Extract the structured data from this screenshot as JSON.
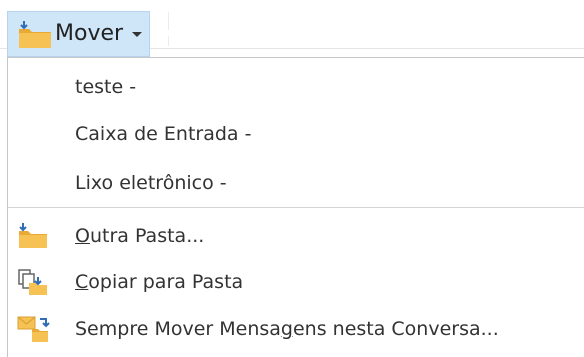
{
  "toolbar": {
    "move_label": "Mover",
    "move_icon": "move-folder-icon"
  },
  "menu": {
    "recent_folders": [
      {
        "label": "teste -"
      },
      {
        "label": "Caixa de Entrada -"
      },
      {
        "label": "Lixo eletrônico -"
      }
    ],
    "other_folder": {
      "label_pre": "",
      "label_ul": "O",
      "label_post": "utra Pasta...",
      "icon": "move-folder-icon"
    },
    "copy_to_folder": {
      "label_pre": "",
      "label_ul": "C",
      "label_post": "opiar para Pasta",
      "icon": "copy-to-folder-icon"
    },
    "always_move": {
      "label_pre": "Sempre Mover Mensa",
      "label_ul": "g",
      "label_post": "ens nesta Conversa...",
      "icon": "always-move-icon"
    }
  },
  "colors": {
    "button_highlight": "#cfe5f8",
    "folder_yellow": "#f5c253",
    "arrow_blue": "#2f6db5"
  }
}
